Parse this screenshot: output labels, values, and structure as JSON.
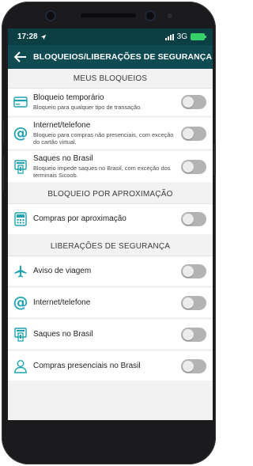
{
  "status": {
    "time": "17:28",
    "network": "3G"
  },
  "appbar": {
    "back_icon": "arrow-left-icon",
    "title": "BLOQUEIOS/LIBERAÇÕES DE SEGURANÇA"
  },
  "sections": {
    "meus_bloqueios": {
      "title": "MEUS BLOQUEIOS",
      "items": [
        {
          "icon": "credit-card-icon",
          "label": "Bloqueio temporário",
          "desc": "Bloqueio para qualquer tipo de transação.",
          "enabled": false
        },
        {
          "icon": "at-icon",
          "label": "Internet/telefone",
          "desc": "Bloqueio para compras não presenciais, com exceção do cartão virtual.",
          "enabled": false
        },
        {
          "icon": "atm-icon",
          "label": "Saques no Brasil",
          "desc": "Bloqueio impede saques no Brasil, com exceção dos terminais Sicoob.",
          "enabled": false
        }
      ]
    },
    "aproximacao": {
      "title": "BLOQUEIO POR APROXIMAÇÃO",
      "items": [
        {
          "icon": "contactless-card-icon",
          "label": "Compras por aproximação",
          "enabled": false
        }
      ]
    },
    "liberacoes": {
      "title": "LIBERAÇÕES DE SEGURANÇA",
      "items": [
        {
          "icon": "airplane-icon",
          "label": "Aviso de viagem",
          "enabled": false
        },
        {
          "icon": "at-icon",
          "label": "Internet/telefone",
          "enabled": false
        },
        {
          "icon": "atm-icon",
          "label": "Saques no Brasil",
          "enabled": false
        },
        {
          "icon": "person-icon",
          "label": "Compras presenciais no Brasil",
          "enabled": false
        }
      ]
    }
  },
  "colors": {
    "statusbar": "#0c3f44",
    "appbar": "#0f4b52",
    "accent": "#1fa3b0",
    "toggle_off": "#b3b3b3"
  }
}
